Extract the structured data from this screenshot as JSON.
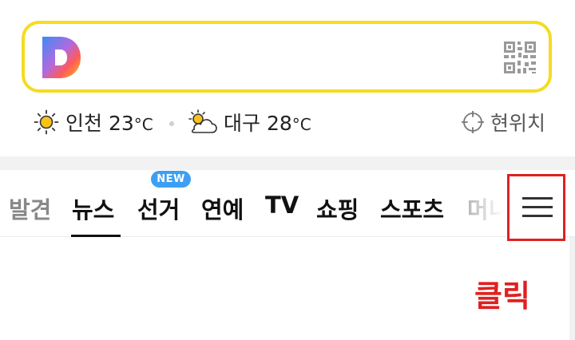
{
  "search": {
    "logo_icon": "daum-d-logo-icon",
    "qr_icon": "qr-code-icon"
  },
  "weather": [
    {
      "icon": "sun-icon",
      "city": "인천",
      "temp": "23",
      "unit": "°C"
    },
    {
      "icon": "partly-cloudy-icon",
      "city": "대구",
      "temp": "28",
      "unit": "°C"
    }
  ],
  "location": {
    "icon": "crosshair-icon",
    "label": "현위치"
  },
  "tabs": [
    {
      "label": "발견"
    },
    {
      "label": "뉴스",
      "active": true
    },
    {
      "label": "선거",
      "badge": "NEW"
    },
    {
      "label": "연예"
    },
    {
      "label": "TV"
    },
    {
      "label": "쇼핑"
    },
    {
      "label": "스포츠"
    },
    {
      "label": "머니"
    }
  ],
  "menu": {
    "icon": "hamburger-menu-icon"
  },
  "annotation": {
    "text": "클릭",
    "color": "#e02020"
  },
  "colors": {
    "search_border": "#f5dc1e",
    "badge": "#3d9ff3",
    "highlight": "#e02020"
  }
}
